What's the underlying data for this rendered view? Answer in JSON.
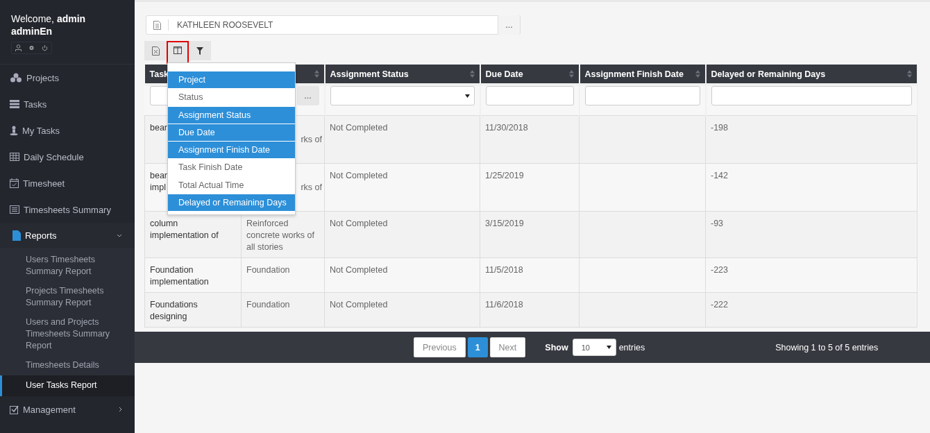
{
  "sidebar": {
    "welcome": "Welcome, **admin adminEn**",
    "items": [
      {
        "label": "Projects"
      },
      {
        "label": "Tasks"
      },
      {
        "label": "My Tasks"
      },
      {
        "label": "Daily Schedule"
      },
      {
        "label": "Timesheet"
      },
      {
        "label": "Timesheets Summary"
      },
      {
        "label": "Reports",
        "expanded": true,
        "children": [
          {
            "label": "Users Timesheets Summary Report",
            "selected": false
          },
          {
            "label": "Projects Timesheets Summary Report",
            "selected": false
          },
          {
            "label": "Users and Projects Timesheets Summary Report",
            "selected": false
          },
          {
            "label": "Timesheets Details",
            "selected": false
          },
          {
            "label": "User Tasks Report",
            "selected": true
          }
        ]
      },
      {
        "label": "Management",
        "expanded": false
      }
    ]
  },
  "user_field": {
    "value": "KATHLEEN ROOSEVELT",
    "button": "..."
  },
  "column_menu": {
    "items": [
      {
        "label": "Project",
        "selected": true
      },
      {
        "label": "Status",
        "selected": false
      },
      {
        "label": "Assignment Status",
        "selected": true
      },
      {
        "label": "Due Date",
        "selected": true
      },
      {
        "label": "Assignment Finish Date",
        "selected": true
      },
      {
        "label": "Task Finish Date",
        "selected": false
      },
      {
        "label": "Total Actual Time",
        "selected": false
      },
      {
        "label": "Delayed or Remaining Days",
        "selected": true
      }
    ]
  },
  "table": {
    "columns": [
      {
        "label": "Task"
      },
      {
        "sortable": true
      },
      {
        "label": "Assignment Status",
        "sortable": true
      },
      {
        "label": "Due Date",
        "sortable": true
      },
      {
        "label": "Assignment Finish Date",
        "sortable": true
      },
      {
        "label": "Delayed or Remaining Days",
        "sortable": true
      }
    ],
    "filters": [
      {
        "kind": "text"
      },
      {
        "kind": "picker",
        "button": "..."
      },
      {
        "kind": "select"
      },
      {
        "kind": "text"
      },
      {
        "kind": "text"
      },
      {
        "kind": "text"
      }
    ],
    "rows": [
      [
        "bear",
        {
          "text": "rks of",
          "clipped_start": true
        },
        "Not Completed",
        "11/30/2018",
        null,
        "-198"
      ],
      [
        "bear\nimpl",
        {
          "text": "rks of",
          "clipped_start": true
        },
        "Not Completed",
        "1/25/2019",
        null,
        "-142"
      ],
      [
        "column implementation of",
        "Reinforced concrete works of all stories",
        "Not Completed",
        "3/15/2019",
        null,
        "-93"
      ],
      [
        "Foundation implementation",
        "Foundation",
        "Not Completed",
        "11/5/2018",
        null,
        "-223"
      ],
      [
        "Foundations designing",
        "Foundation",
        "Not Completed",
        "11/6/2018",
        null,
        "-222"
      ]
    ]
  },
  "footer": {
    "pages": [
      {
        "label": "Previous",
        "kind": "nav",
        "selected": false
      },
      {
        "label": "1",
        "kind": "page",
        "selected": true
      },
      {
        "label": "Next",
        "kind": "nav",
        "selected": false
      }
    ],
    "show_label": "Show",
    "page_size": "10",
    "entries_label": "entries",
    "summary": "Showing 1 to 5 of 5 entries"
  }
}
